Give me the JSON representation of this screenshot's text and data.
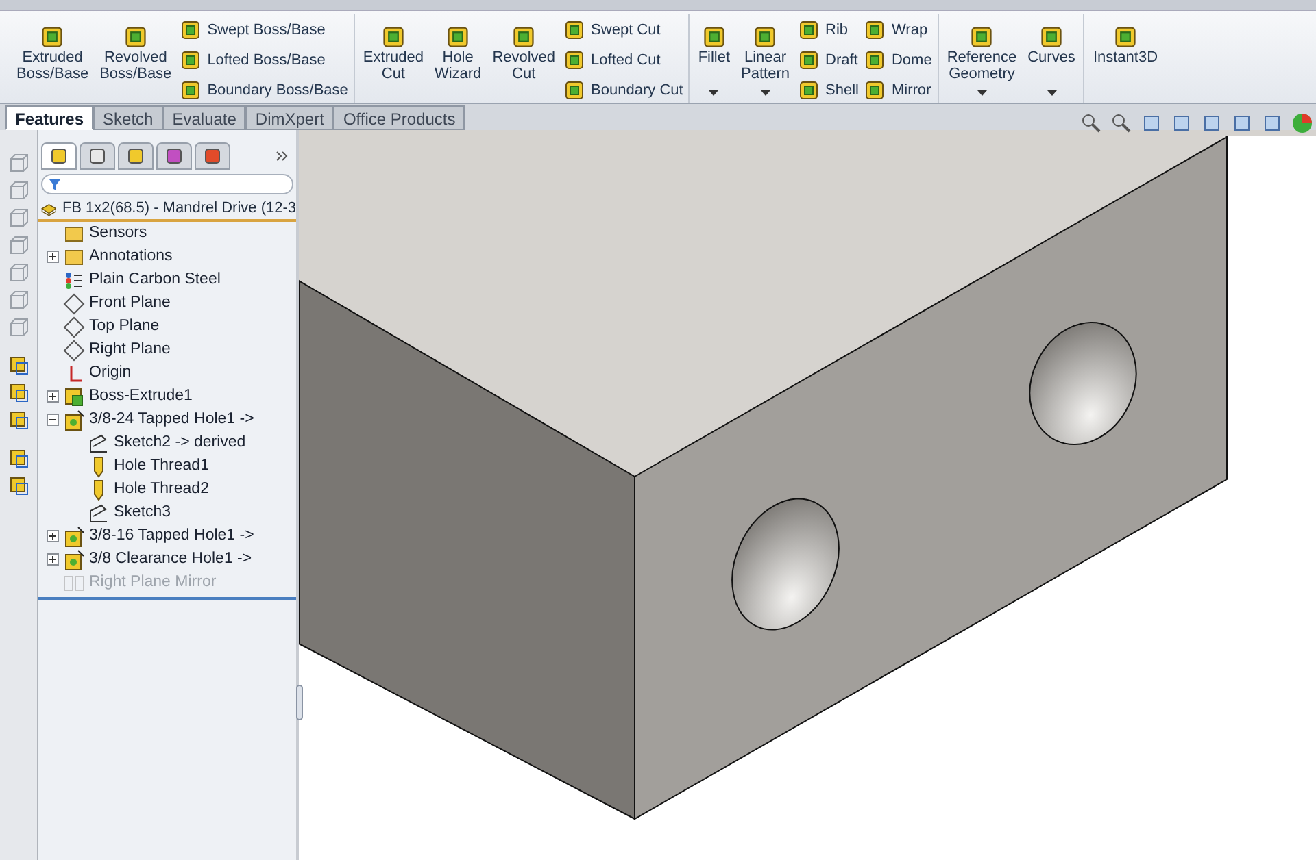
{
  "ribbon": {
    "groups": [
      {
        "items": [
          {
            "kind": "large",
            "lines": [
              "Extruded",
              "Boss/Base"
            ],
            "dropdown": false
          },
          {
            "kind": "large",
            "lines": [
              "Revolved",
              "Boss/Base"
            ],
            "dropdown": false
          },
          {
            "kind": "stack",
            "entries": [
              "Swept Boss/Base",
              "Lofted Boss/Base",
              "Boundary Boss/Base"
            ]
          }
        ]
      },
      {
        "items": [
          {
            "kind": "large",
            "lines": [
              "Extruded",
              "Cut"
            ],
            "dropdown": false
          },
          {
            "kind": "large",
            "lines": [
              "Hole",
              "Wizard"
            ],
            "dropdown": false
          },
          {
            "kind": "large",
            "lines": [
              "Revolved",
              "Cut"
            ],
            "dropdown": false
          },
          {
            "kind": "stack",
            "entries": [
              "Swept Cut",
              "Lofted Cut",
              "Boundary Cut"
            ]
          }
        ]
      },
      {
        "items": [
          {
            "kind": "large",
            "lines": [
              "Fillet"
            ],
            "dropdown": true
          },
          {
            "kind": "large",
            "lines": [
              "Linear",
              "Pattern"
            ],
            "dropdown": true
          },
          {
            "kind": "stack",
            "entries": [
              "Rib",
              "Draft",
              "Shell"
            ]
          },
          {
            "kind": "stack",
            "entries": [
              "Wrap",
              "Dome",
              "Mirror"
            ]
          }
        ]
      },
      {
        "items": [
          {
            "kind": "large",
            "lines": [
              "Reference",
              "Geometry"
            ],
            "dropdown": true
          },
          {
            "kind": "large",
            "lines": [
              "Curves"
            ],
            "dropdown": true
          }
        ]
      },
      {
        "items": [
          {
            "kind": "large",
            "lines": [
              "Instant3D"
            ],
            "dropdown": false
          }
        ]
      }
    ]
  },
  "tabs": [
    {
      "label": "Features",
      "selected": true
    },
    {
      "label": "Sketch",
      "selected": false
    },
    {
      "label": "Evaluate",
      "selected": false
    },
    {
      "label": "DimXpert",
      "selected": false
    },
    {
      "label": "Office Products",
      "selected": false
    }
  ],
  "tree": {
    "root": "FB 1x2(68.5) - Mandrel Drive (12-3",
    "items": [
      {
        "label": "Sensors",
        "kind": "folder",
        "disabled": false
      },
      {
        "label": "Annotations",
        "kind": "folder",
        "expanded": false,
        "disabled": false
      },
      {
        "label": "Plain Carbon Steel",
        "kind": "material",
        "disabled": false
      },
      {
        "label": "Front Plane",
        "kind": "plane",
        "disabled": false
      },
      {
        "label": "Top Plane",
        "kind": "plane",
        "disabled": false
      },
      {
        "label": "Right Plane",
        "kind": "plane",
        "disabled": false
      },
      {
        "label": "Origin",
        "kind": "origin",
        "disabled": false
      },
      {
        "label": "Boss-Extrude1",
        "kind": "feature",
        "expanded": false,
        "disabled": false
      },
      {
        "label": "3/8-24 Tapped Hole1 ->",
        "kind": "hole",
        "expanded": true,
        "disabled": false,
        "children": [
          {
            "label": "Sketch2 -> derived",
            "kind": "sketch",
            "disabled": false
          },
          {
            "label": "Hole Thread1",
            "kind": "thread",
            "disabled": false
          },
          {
            "label": "Hole Thread2",
            "kind": "thread",
            "disabled": false
          },
          {
            "label": "Sketch3",
            "kind": "sketch",
            "disabled": false
          }
        ]
      },
      {
        "label": "3/8-16 Tapped Hole1 ->",
        "kind": "hole",
        "expanded": false,
        "disabled": false
      },
      {
        "label": "3/8 Clearance Hole1 ->",
        "kind": "hole",
        "expanded": false,
        "disabled": false
      },
      {
        "label": "Right Plane Mirror",
        "kind": "mirror",
        "disabled": true
      }
    ]
  }
}
